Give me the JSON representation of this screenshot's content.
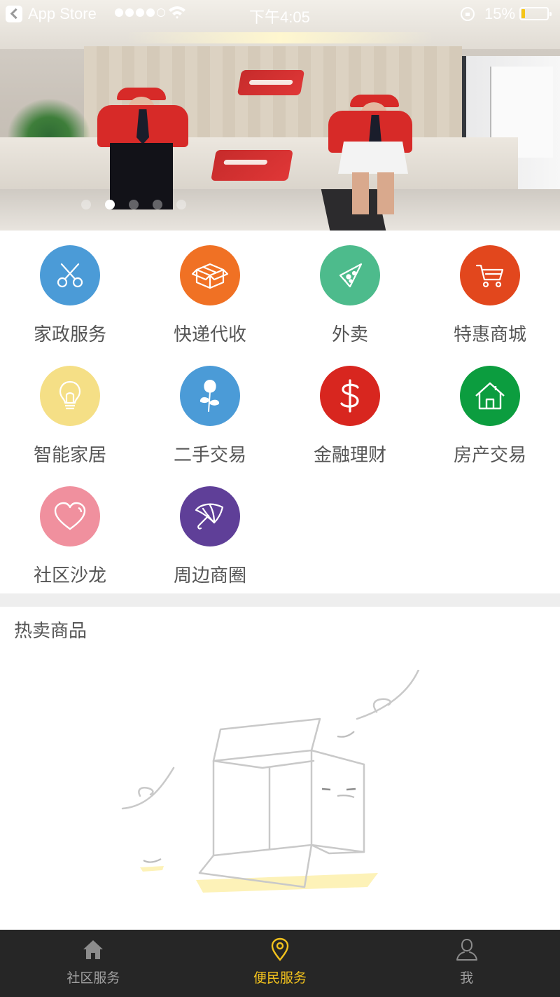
{
  "status_bar": {
    "back_app": "App Store",
    "time": "下午4:05",
    "battery": "15%"
  },
  "banner": {
    "slides": 5,
    "active_slide": 2
  },
  "services": [
    {
      "label": "家政服务",
      "icon": "scissors-icon",
      "color": "#4b9bd7"
    },
    {
      "label": "快递代收",
      "icon": "box-icon",
      "color": "#f07124"
    },
    {
      "label": "外卖",
      "icon": "pizza-icon",
      "color": "#4dbb8c"
    },
    {
      "label": "特惠商城",
      "icon": "cart-icon",
      "color": "#e2471d"
    },
    {
      "label": "智能家居",
      "icon": "lightbulb-icon",
      "color": "#f5df86"
    },
    {
      "label": "二手交易",
      "icon": "rose-icon",
      "color": "#4b9bd7"
    },
    {
      "label": "金融理财",
      "icon": "dollar-icon",
      "color": "#d8261f"
    },
    {
      "label": "房产交易",
      "icon": "house-icon",
      "color": "#0c9d3f"
    },
    {
      "label": "社区沙龙",
      "icon": "heart-icon",
      "color": "#f0909e"
    },
    {
      "label": "周边商圈",
      "icon": "umbrella-icon",
      "color": "#5f3f98"
    }
  ],
  "hot_section": {
    "title": "热卖商品"
  },
  "tabbar": {
    "tabs": [
      {
        "label": "社区服务",
        "icon": "home-icon",
        "active": false
      },
      {
        "label": "便民服务",
        "icon": "location-pin-icon",
        "active": true
      },
      {
        "label": "我",
        "icon": "user-icon",
        "active": false
      }
    ],
    "active_color": "#f2c21d",
    "inactive_color": "#a0a0a0"
  }
}
